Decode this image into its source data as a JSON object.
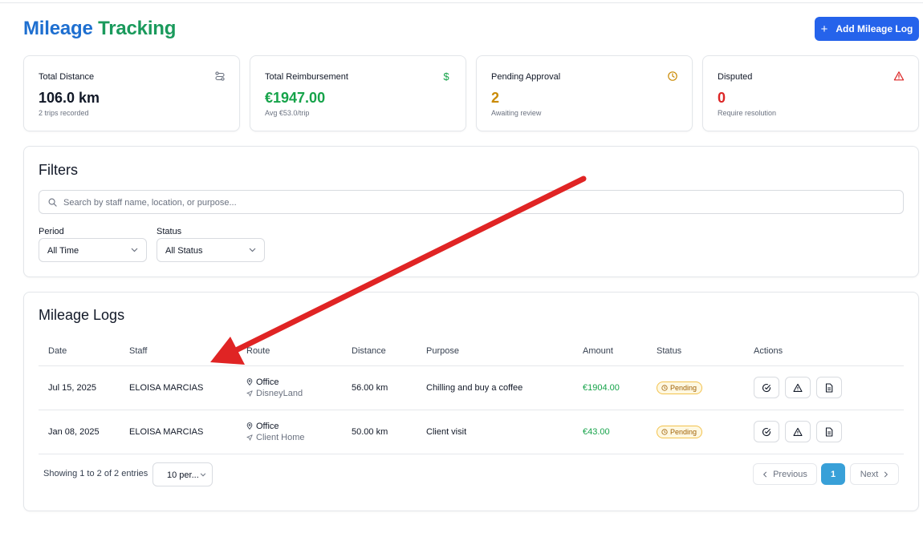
{
  "page": {
    "title_part1": "Mileage",
    "title_part2": "Tracking"
  },
  "header": {
    "add_button_label": "Add Mileage Log",
    "add_icon": "plus-icon"
  },
  "stats": [
    {
      "label": "Total Distance",
      "value": "106.0 km",
      "sub": "2 trips recorded",
      "icon": "route-icon",
      "color": "#111827"
    },
    {
      "label": "Total Reimbursement",
      "value": "€1947.00",
      "sub": "Avg €53.0/trip",
      "icon": "dollar-icon",
      "color": "#16a34a"
    },
    {
      "label": "Pending Approval",
      "value": "2",
      "sub": "Awaiting review",
      "icon": "clock-icon",
      "color": "#ca8a04"
    },
    {
      "label": "Disputed",
      "value": "0",
      "sub": "Require resolution",
      "icon": "alert-triangle-icon",
      "color": "#dc2626"
    }
  ],
  "filters": {
    "title": "Filters",
    "search_placeholder": "Search by staff name, location, or purpose...",
    "period_label": "Period",
    "period_value": "All Time",
    "status_label": "Status",
    "status_value": "All Status"
  },
  "logs": {
    "title": "Mileage Logs",
    "columns": [
      "Date",
      "Staff",
      "Route",
      "Distance",
      "Purpose",
      "Amount",
      "Status",
      "Actions"
    ],
    "rows": [
      {
        "date": "Jul 15, 2025",
        "staff": "ELOISA MARCIAS",
        "from": "Office",
        "to": "DisneyLand",
        "distance": "56.00 km",
        "purpose": "Chilling and buy a coffee",
        "amount": "€1904.00",
        "status": "Pending"
      },
      {
        "date": "Jan 08, 2025",
        "staff": "ELOISA MARCIAS",
        "from": "Office",
        "to": "Client Home",
        "distance": "50.00 km",
        "purpose": "Client visit",
        "amount": "€43.00",
        "status": "Pending"
      }
    ],
    "showing_text": "Showing 1 to 2 of 2 entries",
    "per_page_value": "10 per...",
    "prev_label": "Previous",
    "next_label": "Next",
    "current_page": "1"
  },
  "colors": {
    "primary": "#2563eb",
    "title_blue": "#1e6fd0",
    "title_green": "#1a9a5c",
    "success": "#16a34a",
    "warning": "#ca8a04",
    "danger": "#dc2626",
    "page_active": "#38a0d8",
    "annotation_arrow": "#e02424"
  }
}
